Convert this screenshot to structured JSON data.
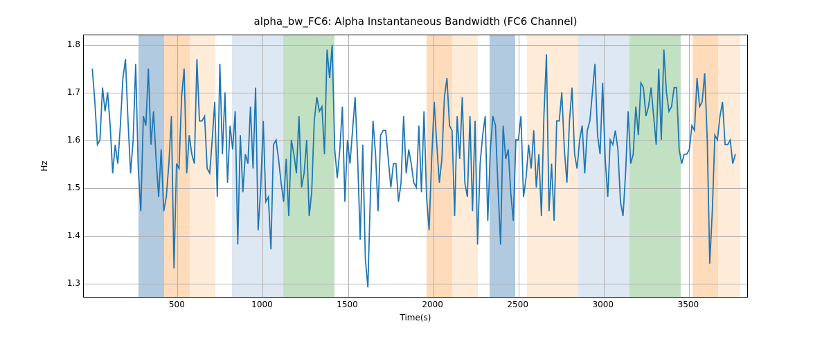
{
  "chart_data": {
    "type": "line",
    "title": "alpha_bw_FC6: Alpha Instantaneous Bandwidth (FC6 Channel)",
    "xlabel": "Time(s)",
    "ylabel": "Hz",
    "xlim": [
      -50,
      3850
    ],
    "ylim": [
      1.27,
      1.82
    ],
    "xticks": [
      500,
      1000,
      1500,
      2000,
      2500,
      3000,
      3500
    ],
    "yticks": [
      1.3,
      1.4,
      1.5,
      1.6,
      1.7,
      1.8
    ],
    "bands": [
      {
        "start": 270,
        "end": 420,
        "style": "blue-dark"
      },
      {
        "start": 420,
        "end": 570,
        "style": "orange-dark"
      },
      {
        "start": 570,
        "end": 720,
        "style": "orange-light"
      },
      {
        "start": 820,
        "end": 970,
        "style": "blue-light"
      },
      {
        "start": 970,
        "end": 1120,
        "style": "blue-light"
      },
      {
        "start": 1120,
        "end": 1270,
        "style": "green"
      },
      {
        "start": 1270,
        "end": 1420,
        "style": "green"
      },
      {
        "start": 1960,
        "end": 2110,
        "style": "orange-dark"
      },
      {
        "start": 2110,
        "end": 2260,
        "style": "orange-light"
      },
      {
        "start": 2330,
        "end": 2480,
        "style": "blue-dark"
      },
      {
        "start": 2550,
        "end": 2700,
        "style": "orange-light"
      },
      {
        "start": 2700,
        "end": 2850,
        "style": "orange-light"
      },
      {
        "start": 2850,
        "end": 3000,
        "style": "blue-light"
      },
      {
        "start": 3000,
        "end": 3150,
        "style": "blue-light"
      },
      {
        "start": 3150,
        "end": 3300,
        "style": "green"
      },
      {
        "start": 3300,
        "end": 3450,
        "style": "green"
      },
      {
        "start": 3520,
        "end": 3670,
        "style": "orange-dark"
      },
      {
        "start": 3670,
        "end": 3800,
        "style": "orange-light"
      }
    ],
    "xstep": 15,
    "y": [
      1.75,
      1.68,
      1.59,
      1.6,
      1.71,
      1.66,
      1.7,
      1.63,
      1.53,
      1.59,
      1.55,
      1.63,
      1.73,
      1.77,
      1.64,
      1.53,
      1.6,
      1.76,
      1.54,
      1.45,
      1.65,
      1.63,
      1.75,
      1.59,
      1.66,
      1.56,
      1.48,
      1.58,
      1.45,
      1.48,
      1.55,
      1.65,
      1.33,
      1.55,
      1.54,
      1.69,
      1.75,
      1.53,
      1.61,
      1.57,
      1.55,
      1.77,
      1.64,
      1.64,
      1.65,
      1.54,
      1.53,
      1.6,
      1.68,
      1.48,
      1.76,
      1.57,
      1.7,
      1.51,
      1.63,
      1.58,
      1.66,
      1.38,
      1.61,
      1.49,
      1.57,
      1.55,
      1.67,
      1.54,
      1.71,
      1.41,
      1.5,
      1.64,
      1.47,
      1.48,
      1.37,
      1.59,
      1.6,
      1.56,
      1.51,
      1.47,
      1.56,
      1.44,
      1.6,
      1.57,
      1.53,
      1.65,
      1.5,
      1.53,
      1.6,
      1.44,
      1.49,
      1.64,
      1.69,
      1.66,
      1.67,
      1.57,
      1.79,
      1.73,
      1.8,
      1.58,
      1.52,
      1.58,
      1.67,
      1.47,
      1.6,
      1.55,
      1.62,
      1.69,
      1.56,
      1.39,
      1.59,
      1.35,
      1.29,
      1.49,
      1.64,
      1.57,
      1.45,
      1.61,
      1.62,
      1.62,
      1.56,
      1.5,
      1.55,
      1.55,
      1.47,
      1.51,
      1.65,
      1.53,
      1.58,
      1.55,
      1.51,
      1.5,
      1.63,
      1.49,
      1.66,
      1.48,
      1.41,
      1.56,
      1.68,
      1.59,
      1.51,
      1.56,
      1.69,
      1.73,
      1.63,
      1.62,
      1.44,
      1.65,
      1.56,
      1.69,
      1.51,
      1.48,
      1.65,
      1.45,
      1.64,
      1.38,
      1.55,
      1.61,
      1.65,
      1.43,
      1.58,
      1.65,
      1.63,
      1.5,
      1.38,
      1.63,
      1.56,
      1.58,
      1.49,
      1.43,
      1.6,
      1.6,
      1.65,
      1.48,
      1.52,
      1.59,
      1.54,
      1.62,
      1.5,
      1.57,
      1.44,
      1.65,
      1.78,
      1.45,
      1.55,
      1.43,
      1.64,
      1.64,
      1.7,
      1.58,
      1.51,
      1.64,
      1.71,
      1.57,
      1.54,
      1.6,
      1.63,
      1.53,
      1.62,
      1.64,
      1.7,
      1.76,
      1.61,
      1.57,
      1.72,
      1.56,
      1.48,
      1.6,
      1.59,
      1.62,
      1.58,
      1.47,
      1.44,
      1.53,
      1.66,
      1.55,
      1.57,
      1.67,
      1.61,
      1.72,
      1.71,
      1.65,
      1.67,
      1.71,
      1.65,
      1.59,
      1.75,
      1.6,
      1.79,
      1.7,
      1.66,
      1.67,
      1.71,
      1.71,
      1.58,
      1.55,
      1.57,
      1.57,
      1.58,
      1.63,
      1.62,
      1.73,
      1.67,
      1.68,
      1.74,
      1.6,
      1.34,
      1.45,
      1.61,
      1.6,
      1.65,
      1.68,
      1.59,
      1.59,
      1.6,
      1.55,
      1.57
    ]
  }
}
